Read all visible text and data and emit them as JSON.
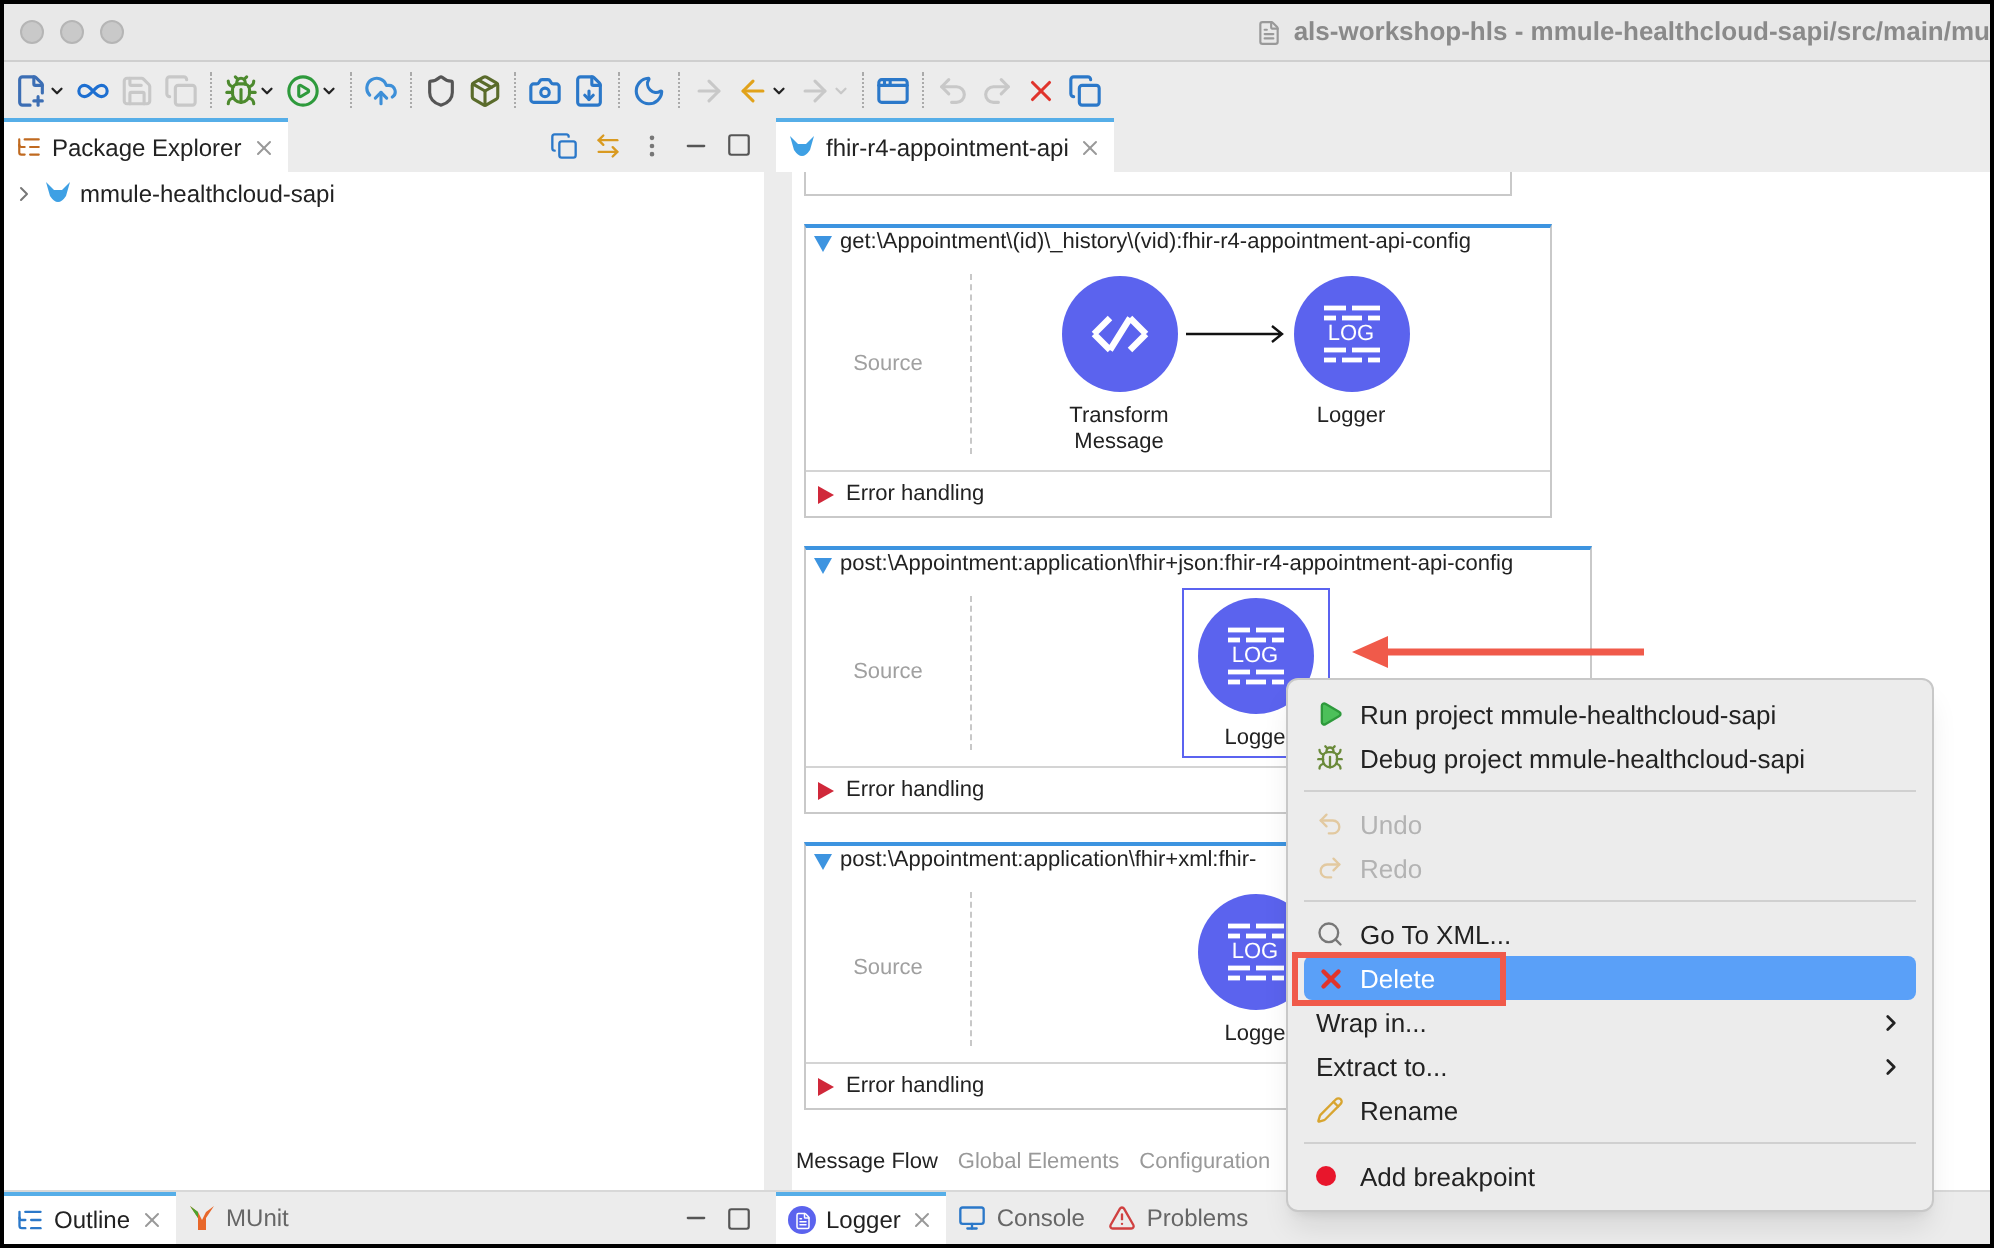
{
  "window": {
    "title": "als-workshop-hls - mmule-healthcloud-sapi/src/main/mu"
  },
  "toolbar": [
    {
      "kind": "new",
      "disabled": false,
      "dropdown": true
    },
    {
      "kind": "connect",
      "disabled": false,
      "dropdown": false
    },
    {
      "kind": "save",
      "disabled": true,
      "dropdown": false
    },
    {
      "kind": "saveall",
      "disabled": true,
      "dropdown": false
    },
    {
      "kind": "separator"
    },
    {
      "kind": "debug",
      "disabled": false,
      "dropdown": true
    },
    {
      "kind": "run",
      "disabled": false,
      "dropdown": true
    },
    {
      "kind": "separator"
    },
    {
      "kind": "deploy",
      "disabled": false,
      "dropdown": false
    },
    {
      "kind": "separator"
    },
    {
      "kind": "mule",
      "disabled": false,
      "dropdown": false
    },
    {
      "kind": "jar",
      "disabled": false,
      "dropdown": false
    },
    {
      "kind": "separator"
    },
    {
      "kind": "camera",
      "disabled": false,
      "dropdown": false
    },
    {
      "kind": "import",
      "disabled": false,
      "dropdown": false
    },
    {
      "kind": "separator"
    },
    {
      "kind": "moon",
      "disabled": false,
      "dropdown": false
    },
    {
      "kind": "separator"
    },
    {
      "kind": "annotation",
      "disabled": true,
      "dropdown": false
    },
    {
      "kind": "back",
      "disabled": false,
      "dropdown": true
    },
    {
      "kind": "forward",
      "disabled": true,
      "dropdown": true
    },
    {
      "kind": "separator"
    },
    {
      "kind": "perspective",
      "disabled": false,
      "dropdown": false
    },
    {
      "kind": "separator"
    },
    {
      "kind": "undo",
      "disabled": true,
      "dropdown": false
    },
    {
      "kind": "redo",
      "disabled": true,
      "dropdown": false
    },
    {
      "kind": "delete",
      "disabled": false,
      "dropdown": false
    },
    {
      "kind": "minimize",
      "disabled": false,
      "dropdown": false
    }
  ],
  "package_explorer": {
    "tab": {
      "label": "Package Explorer",
      "selected": true
    },
    "tree": [
      {
        "label": "mmule-healthcloud-sapi",
        "expanded": false
      }
    ]
  },
  "editor": {
    "tabs": [
      {
        "label": "fhir-r4-appointment-api",
        "selected": true
      }
    ],
    "flows": [
      {
        "header": "get:\\Appointment\\(id)\\_history\\(vid):fhir-r4-appointment-api-config",
        "expanded": true,
        "source": "Source",
        "nodes": [
          {
            "kind": "transform",
            "label": "Transform Message",
            "selected": false
          },
          {
            "kind": "logger",
            "label": "Logger",
            "icon_text": "LOG",
            "selected": false
          }
        ],
        "error_handling": {
          "label": "Error handling",
          "expanded": false
        }
      },
      {
        "header": "post:\\Appointment:application\\fhir+json:fhir-r4-appointment-api-config",
        "expanded": true,
        "source": "Source",
        "nodes": [
          {
            "kind": "logger",
            "label": "Logge",
            "icon_text": "LOG",
            "selected": true
          }
        ],
        "error_handling": {
          "label": "Error handling",
          "expanded": false
        }
      },
      {
        "header": "post:\\Appointment:application\\fhir+xml:fhir-",
        "expanded": true,
        "source": "Source",
        "nodes": [
          {
            "kind": "logger",
            "label": "Logge",
            "icon_text": "LOG",
            "selected": false
          }
        ],
        "error_handling": {
          "label": "Error handling",
          "expanded": false
        }
      }
    ],
    "view_tabs": [
      {
        "label": "Message Flow",
        "selected": true
      },
      {
        "label": "Global Elements",
        "selected": false
      },
      {
        "label": "Configuration",
        "selected": false
      }
    ]
  },
  "context_menu": {
    "groups": [
      [
        {
          "kind": "run",
          "label": "Run project mmule-healthcloud-sapi",
          "disabled": false,
          "selected": false,
          "submenu": false
        },
        {
          "kind": "debug",
          "label": "Debug project mmule-healthcloud-sapi",
          "disabled": false,
          "selected": false,
          "submenu": false
        }
      ],
      [
        {
          "kind": "undo",
          "label": "Undo",
          "disabled": true,
          "selected": false,
          "submenu": false
        },
        {
          "kind": "redo",
          "label": "Redo",
          "disabled": true,
          "selected": false,
          "submenu": false
        }
      ],
      [
        {
          "kind": "goto",
          "label": "Go To XML...",
          "disabled": false,
          "selected": false,
          "submenu": false
        },
        {
          "kind": "delete",
          "label": "Delete",
          "disabled": false,
          "selected": true,
          "submenu": false
        },
        {
          "kind": "plain",
          "label": "Wrap in...",
          "disabled": false,
          "selected": false,
          "submenu": true
        },
        {
          "kind": "plain",
          "label": "Extract to...",
          "disabled": false,
          "selected": false,
          "submenu": true
        },
        {
          "kind": "rename",
          "label": "Rename",
          "disabled": false,
          "selected": false,
          "submenu": false
        }
      ],
      [
        {
          "kind": "breakpoint",
          "label": "Add breakpoint",
          "disabled": false,
          "selected": false,
          "submenu": false
        }
      ]
    ]
  },
  "bottom_left_tabs": [
    {
      "kind": "outline",
      "label": "Outline",
      "selected": true
    },
    {
      "kind": "munit",
      "label": "MUnit",
      "selected": false
    }
  ],
  "bottom_right_tabs": [
    {
      "kind": "logger",
      "label": "Logger",
      "selected": true
    },
    {
      "kind": "console",
      "label": "Console",
      "selected": false
    },
    {
      "kind": "problems",
      "label": "Problems",
      "selected": false
    }
  ]
}
